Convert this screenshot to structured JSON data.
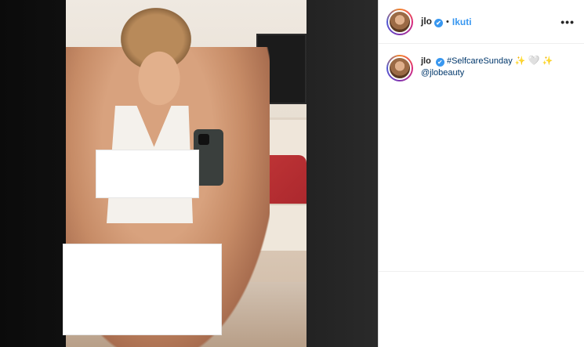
{
  "post": {
    "username": "jlo",
    "verified_mark": "✔",
    "separator": "•",
    "follow_label": "Ikuti",
    "more_label": "•••",
    "caption": {
      "username": "jlo",
      "hashtag": "#SelfcareSunday",
      "emoji_1": "✨",
      "emoji_2": "🤍",
      "emoji_3": "✨",
      "mention": "@jlobeauty"
    }
  },
  "colors": {
    "accent": "#3897f0",
    "link": "#00376b",
    "text": "#262626"
  },
  "icons": [
    "verified-badge-icon",
    "more-options-icon"
  ]
}
